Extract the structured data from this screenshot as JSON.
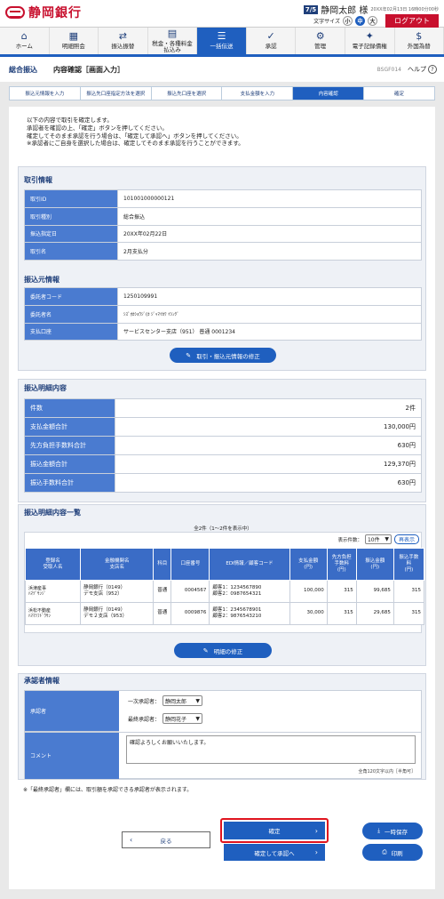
{
  "header": {
    "bank_name": "静岡銀行",
    "user_badge": "7/5",
    "user_name": "静岡太郎 様",
    "timestamp": "20XX年02月13日 16時00分00秒",
    "font_size_label": "文字サイズ",
    "font_sizes": [
      "小",
      "中",
      "大"
    ],
    "logout": "ログアウト"
  },
  "nav": [
    {
      "icon": "⌂",
      "label": "ホーム"
    },
    {
      "icon": "▦",
      "label": "明細照会"
    },
    {
      "icon": "⇄",
      "label": "振込振替"
    },
    {
      "icon": "▤",
      "label": "税金・各種料金\n払込み"
    },
    {
      "icon": "☰",
      "label": "一括伝送"
    },
    {
      "icon": "✓",
      "label": "承認"
    },
    {
      "icon": "⚙",
      "label": "管理"
    },
    {
      "icon": "✦",
      "label": "電子記録債権"
    },
    {
      "icon": "$",
      "label": "外国為替"
    }
  ],
  "page": {
    "breadcrumb": "総合振込",
    "title": "内容確認［画面入力］",
    "screen_id": "BSGF014",
    "help": "ヘルプ"
  },
  "steps": [
    "振込元情報を入力",
    "振込先口座指定方法を選択",
    "振込先口座を選択",
    "支払金額を入力",
    "内容確認",
    "確定"
  ],
  "intro": [
    "以下の内容で取引を確定します。",
    "承認者を確認の上、「確定」ボタンを押してください。",
    "確定してそのまま承認を行う場合は、「確定して承認へ」ボタンを押してください。",
    "※承認者にご自身を選択した場合は、確定してそのまま承認を行うことができます。"
  ],
  "transaction": {
    "title": "取引情報",
    "rows": [
      {
        "k": "取引ID",
        "v": "101001000000121"
      },
      {
        "k": "取引種別",
        "v": "総合振込"
      },
      {
        "k": "振込指定日",
        "v": "20XX年02月22日"
      },
      {
        "k": "取引名",
        "v": "2月支払分"
      }
    ]
  },
  "source": {
    "title": "振込元情報",
    "rows": [
      {
        "k": "委託者コード",
        "v": "1250109991"
      },
      {
        "k": "委託者名",
        "v": "ｼｽﾞｵｶｼｮｳｼﾞ(ｶ ｼﾞｬﾏｲｶﾜ ｲｼﾝｸﾞ"
      },
      {
        "k": "支払口座",
        "v": "サービスセンター支店（951） 普通 0001234"
      }
    ],
    "edit_button": "取引・振込元情報の修正"
  },
  "details": {
    "title": "振込明細内容",
    "rows": [
      {
        "k": "件数",
        "v": "2件"
      },
      {
        "k": "支払金額合計",
        "v": "130,000円"
      },
      {
        "k": "先方負担手数料合計",
        "v": "630円"
      },
      {
        "k": "振込金額合計",
        "v": "129,370円"
      },
      {
        "k": "振込手数料合計",
        "v": "630円"
      }
    ]
  },
  "list": {
    "title": "振込明細内容一覧",
    "count_text": "全2件（1～2件を表示中）",
    "display_count_label": "表示件数：",
    "display_count": "10件",
    "redisplay": "再表示",
    "headers": [
      "登録名\n受取人名",
      "金融機関名\n支店名",
      "科目",
      "口座番号",
      "EDI情報／顧客コード",
      "支払金額\n(円)",
      "先方負担\n手数料\n(円)",
      "振込金額\n(円)",
      "振込手数\n料\n(円)"
    ],
    "rows": [
      [
        "浜津産事\nﾊﾏﾂﾞｻﾝｼﾞ",
        "静岡銀行（0149）\nデモ支店（952）",
        "普通",
        "0004567",
        "顧客1：1234567890\n顧客2：0987654321",
        "100,000",
        "315",
        "99,685",
        "315"
      ],
      [
        "浜松不動産\nﾊﾏﾏﾂﾌﾄﾞｳｻﾝ",
        "静岡銀行（0149）\nデモ２支店（953）",
        "普通",
        "0009876",
        "顧客1：2345678901\n顧客2：9876543210",
        "30,000",
        "315",
        "29,685",
        "315"
      ]
    ],
    "edit_button": "明細の修正"
  },
  "approver": {
    "title": "承認者情報",
    "label": "承認者",
    "first_label": "一次承認者：",
    "first_value": "静岡太郎",
    "final_label": "最終承認者：",
    "final_value": "静岡花子",
    "comment_label": "コメント",
    "comment_value": "確認よろしくお願いいたします。",
    "comment_hint": "全角120文字以内［半角可］"
  },
  "note": "※「最終承認者」欄には、取引額を承認できる承認者が表示されます。",
  "actions": {
    "back": "戻る",
    "confirm": "確定",
    "confirm_approve": "確定して承認へ",
    "save": "一時保存",
    "print": "印刷"
  }
}
